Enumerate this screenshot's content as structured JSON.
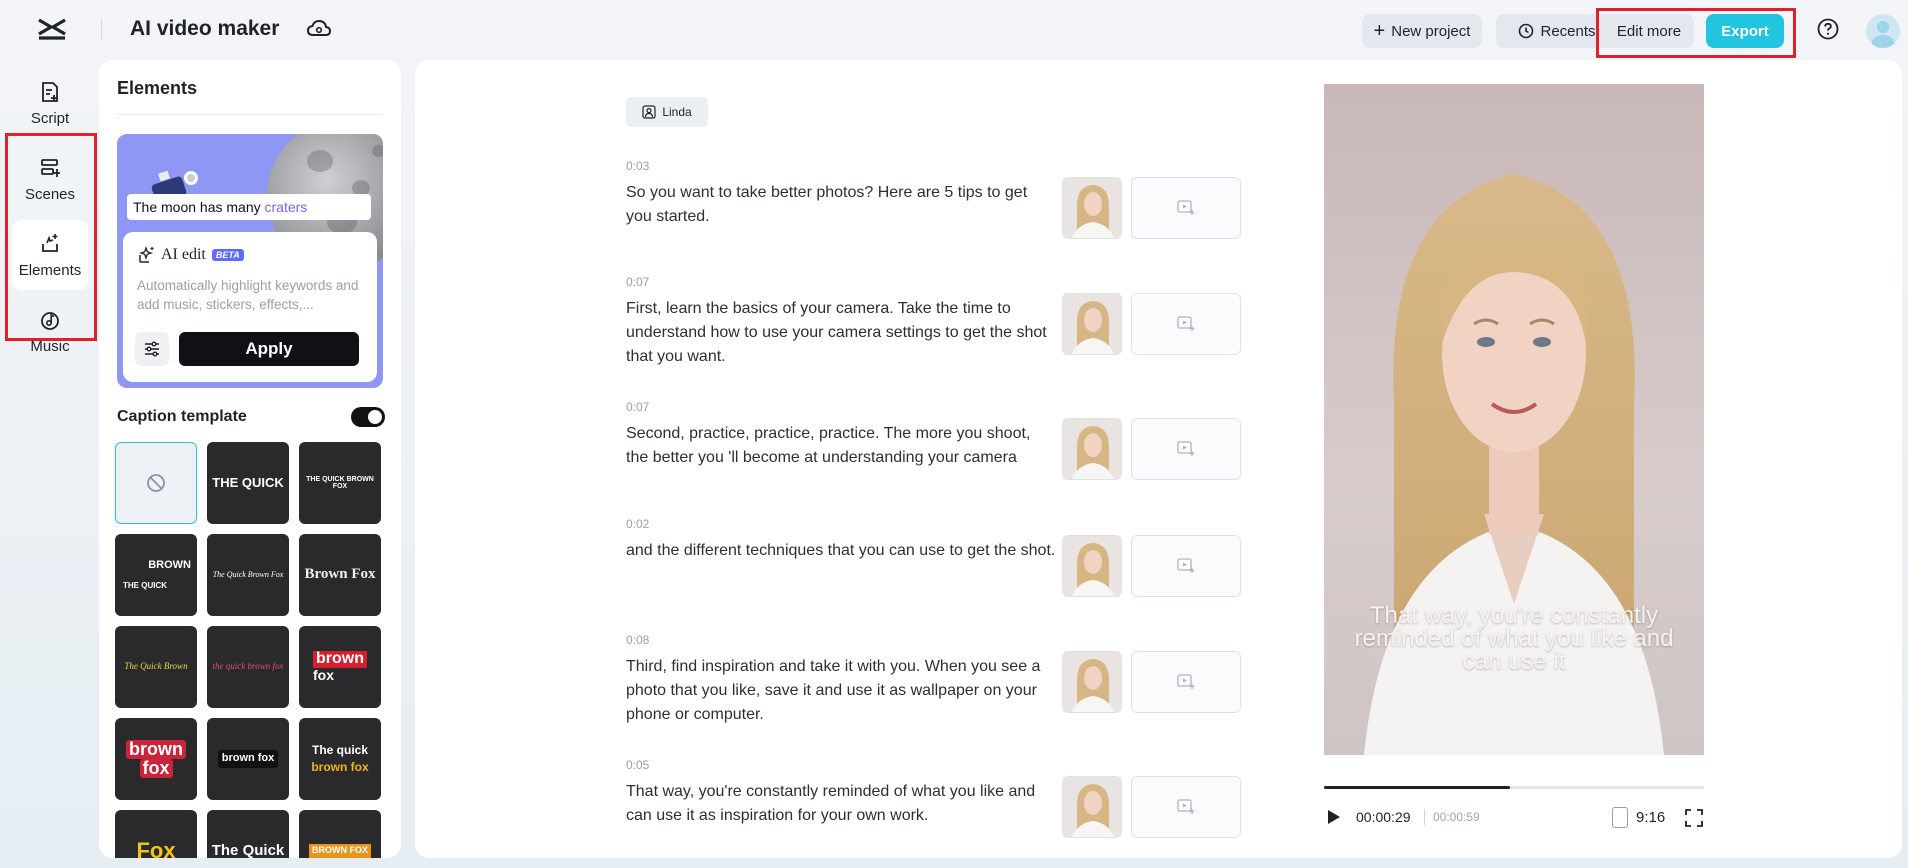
{
  "app": {
    "title": "AI video maker"
  },
  "topbar": {
    "new_project": "New project",
    "recents": "Recents",
    "edit_more": "Edit more",
    "export": "Export"
  },
  "leftnav": {
    "items": [
      {
        "label": "Script",
        "icon": "script-icon"
      },
      {
        "label": "Scenes",
        "icon": "scenes-icon"
      },
      {
        "label": "Elements",
        "icon": "elements-icon",
        "active": true
      },
      {
        "label": "Music",
        "icon": "music-icon"
      }
    ]
  },
  "elements_panel": {
    "title": "Elements",
    "ai_card": {
      "caption_demo": "The moon has many ",
      "caption_highlight": "craters",
      "title": "AI edit",
      "badge": "BETA",
      "description": "Automatically highlight keywords and add music, stickers, effects,...",
      "apply": "Apply"
    },
    "caption_template": {
      "label": "Caption template",
      "enabled": true
    },
    "templates": [
      {
        "id": "none"
      },
      {
        "lines": [
          "THE QUICK"
        ],
        "style": "yellow-white"
      },
      {
        "lines": [
          "THE QUICK BROWN FOX"
        ],
        "style": "small-white"
      },
      {
        "lines": [
          "BROWN",
          "THE QUICK"
        ],
        "style": "stacked"
      },
      {
        "lines": [
          "The Quick Brown Fox"
        ],
        "style": "serif-mix"
      },
      {
        "lines": [
          "Brown Fox"
        ],
        "style": "gothic"
      },
      {
        "lines": [
          "The Quick Brown"
        ],
        "style": "script-yellow"
      },
      {
        "lines": [
          "the quick brown fox"
        ],
        "style": "script-red"
      },
      {
        "lines": [
          "brown",
          "fox"
        ],
        "style": "red-block"
      },
      {
        "lines": [
          "brown",
          "fox"
        ],
        "style": "red-bold"
      },
      {
        "lines": [
          "brown fox"
        ],
        "style": "boxed"
      },
      {
        "lines": [
          "The quick",
          "brown fox"
        ],
        "style": "white-orange"
      },
      {
        "lines": [
          "Fox"
        ],
        "style": "yellow-big"
      },
      {
        "lines": [
          "The Quick"
        ],
        "style": "white-big"
      },
      {
        "lines": [
          "BROWN FOX"
        ],
        "style": "orange-label"
      }
    ]
  },
  "script": {
    "speaker": "Linda",
    "scenes": [
      {
        "time": "0:03",
        "text": "So you want to take better photos? Here are 5 tips to get you started."
      },
      {
        "time": "0:07",
        "text": "First, learn the basics of your camera. Take the time to understand how to use your camera settings to get the shot that you want."
      },
      {
        "time": "0:07",
        "text": "Second, practice, practice, practice. The more you shoot, the better you 'll become at understanding your camera"
      },
      {
        "time": "0:02",
        "text": "and the different techniques that you can use to get the shot."
      },
      {
        "time": "0:08",
        "text": "Third, find inspiration and take it with you. When you see a photo that you like, save it and use it as wallpaper on your phone or computer."
      },
      {
        "time": "0:05",
        "text": "That way, you're constantly reminded of what you like and can use it as inspiration for your own work."
      }
    ]
  },
  "preview": {
    "caption": "That way, you're constantly reminded of what you like and can use it",
    "current_time": "00:00:29",
    "total_time": "00:00:59",
    "progress": 0.49,
    "ratio": "9:16"
  },
  "colors": {
    "accent": "#22c5e0",
    "highlight_box": "#e0202a",
    "ai_card": "#8f97f5"
  }
}
